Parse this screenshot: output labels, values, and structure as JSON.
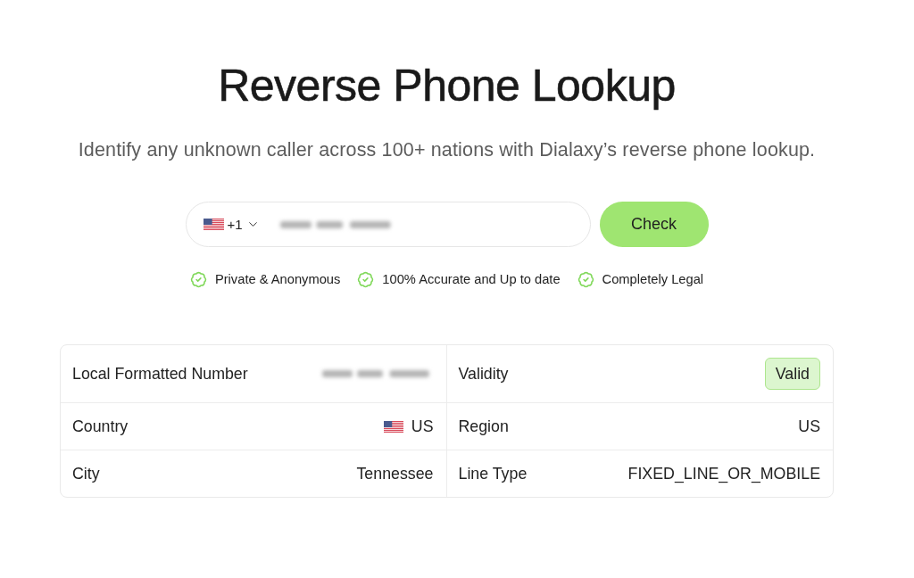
{
  "page": {
    "title": "Reverse Phone Lookup",
    "subtitle": "Identify any unknown caller across 100+ nations with Dialaxy’s reverse phone lookup."
  },
  "search": {
    "country_code": "+1",
    "number_redacted": true,
    "button": "Check"
  },
  "features": [
    "Private & Anonymous",
    "100% Accurate and Up to date",
    "Completely Legal"
  ],
  "results": {
    "rows": [
      {
        "cells": [
          {
            "label": "Local Formatted Number",
            "kind": "redacted"
          },
          {
            "label": "Validity",
            "kind": "badge",
            "value": "Valid"
          }
        ]
      },
      {
        "cells": [
          {
            "label": "Country",
            "kind": "flag",
            "value": "US"
          },
          {
            "label": "Region",
            "kind": "text",
            "value": "US"
          }
        ]
      },
      {
        "cells": [
          {
            "label": "City",
            "kind": "text",
            "value": "Tennessee"
          },
          {
            "label": "Line Type",
            "kind": "text",
            "value": "FIXED_LINE_OR_MOBILE"
          }
        ]
      }
    ]
  }
}
